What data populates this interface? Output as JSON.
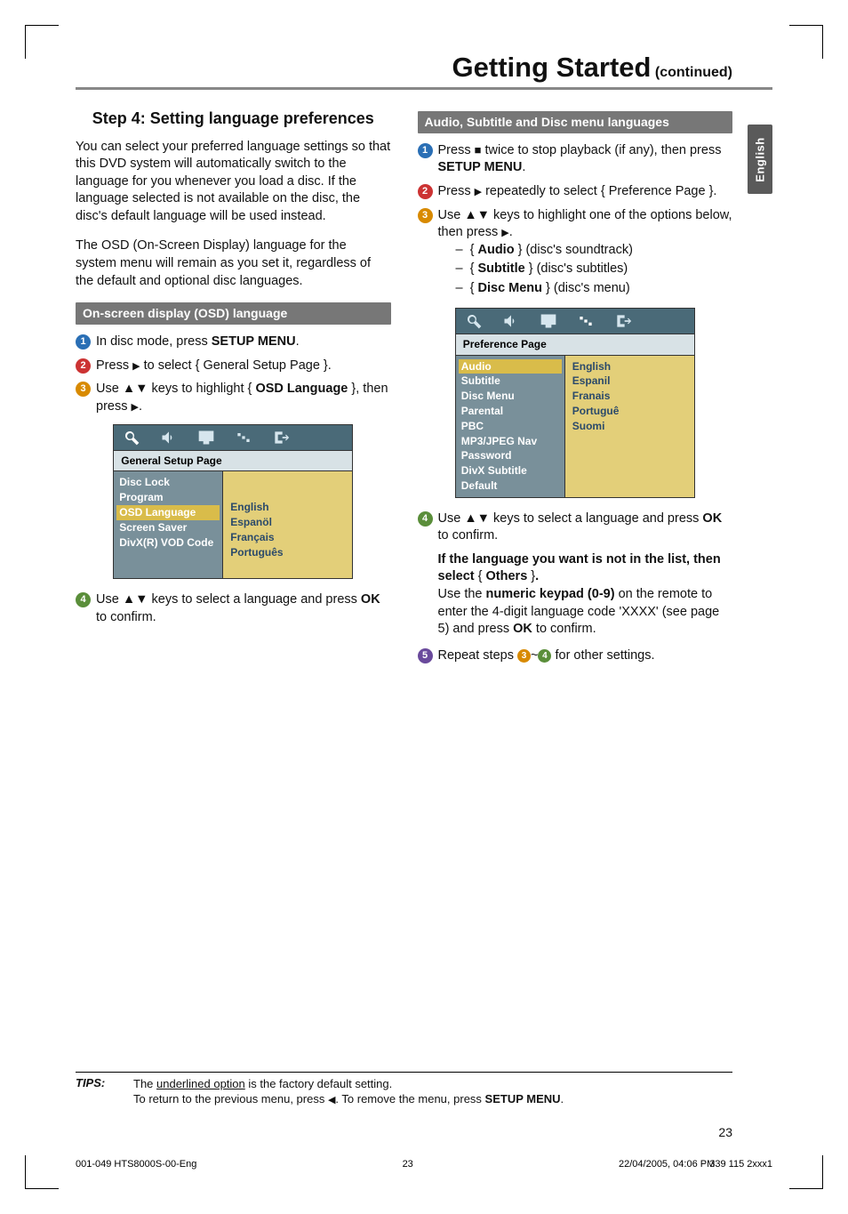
{
  "tab_label": "English",
  "header": {
    "title": "Getting Started",
    "continued": " (continued)"
  },
  "left": {
    "section_step": "Step 4:",
    "section_rest": " Setting language preferences",
    "para1": "You can select your preferred language settings so that this DVD system will automatically switch to the language for you whenever you load a disc.  If the language selected is not available on the disc, the disc's default language will be used instead.",
    "para2": "The OSD (On-Screen Display) language for the system menu will remain as you set it, regardless of the default and optional disc languages.",
    "sub1": "On-screen display (OSD) language",
    "s1": "In disc mode, press ",
    "s1b": "SETUP MENU",
    "s1end": ".",
    "s2a": "Press ",
    "s2b": " to select { General Setup Page }.",
    "s3a": "Use ▲▼ keys to highlight { ",
    "s3b": "OSD Language",
    "s3c": " }, then press ",
    "s3d": ".",
    "osd": {
      "title": "General Setup Page",
      "left": [
        "Disc Lock",
        "Program",
        "OSD Language",
        "Screen Saver",
        "DivX(R) VOD Code"
      ],
      "right": [
        "English",
        "Espanöl",
        "Français",
        "Português"
      ]
    },
    "s4a": "Use ▲▼ keys to select a language and press ",
    "s4b": "OK",
    "s4c": " to confirm."
  },
  "right": {
    "sub": "Audio, Subtitle and Disc menu languages",
    "s1a": "Press  ",
    "s1b": "  twice to stop playback (if any), then press ",
    "s1c": "SETUP MENU",
    "s1d": ".",
    "s2a": "Press ",
    "s2b": " repeatedly to select { Preference Page }.",
    "s3a": "Use ▲▼ keys to highlight one of the options below, then press ",
    "s3b": ".",
    "li1a": "{ ",
    "li1b": "Audio",
    "li1c": " } (disc's soundtrack)",
    "li2a": "{ ",
    "li2b": "Subtitle",
    "li2c": " } (disc's subtitles)",
    "li3a": "{ ",
    "li3b": "Disc Menu",
    "li3c": " } (disc's menu)",
    "osd": {
      "title": "Preference Page",
      "left": [
        "Audio",
        "Subtitle",
        "Disc Menu",
        "Parental",
        "PBC",
        "MP3/JPEG Nav",
        "Password",
        "DivX Subtitle",
        "Default"
      ],
      "left_hl": 0,
      "right": [
        "English",
        "Espanil",
        "Franais",
        "Portuguê",
        "Suomi"
      ]
    },
    "s4a": "Use ▲▼ keys to select a language and press ",
    "s4b": "OK",
    "s4c": " to confirm.",
    "note1": "If the language you want is not in the list, then select ",
    "note1b": "{ ",
    "note1c": "Others",
    "note1d": " }",
    "note1e": ".",
    "note2a": "Use the ",
    "note2b": "numeric keypad (0-9)",
    "note2c": " on the remote to enter the 4-digit language code 'XXXX' (see page 5) and press ",
    "note2d": "OK",
    "note2e": " to confirm.",
    "s5a": "Repeat steps ",
    "s5b": "~",
    "s5c": " for other settings."
  },
  "tips": {
    "label": "TIPS:",
    "line1a": "The ",
    "line1b": "underlined option",
    "line1c": " is the factory default setting.",
    "line2a": "To return to the previous menu, press ",
    "line2b": ".  To remove the menu, press ",
    "line2c": "SETUP MENU",
    "line2d": "."
  },
  "pagenum": "23",
  "footer": {
    "l": "001-049 HTS8000S-00-Eng",
    "c": "23",
    "r": "22/04/2005, 04:06 PM",
    "code": "39 115 2xxx1",
    "codepre": "3"
  },
  "chart_data": null
}
